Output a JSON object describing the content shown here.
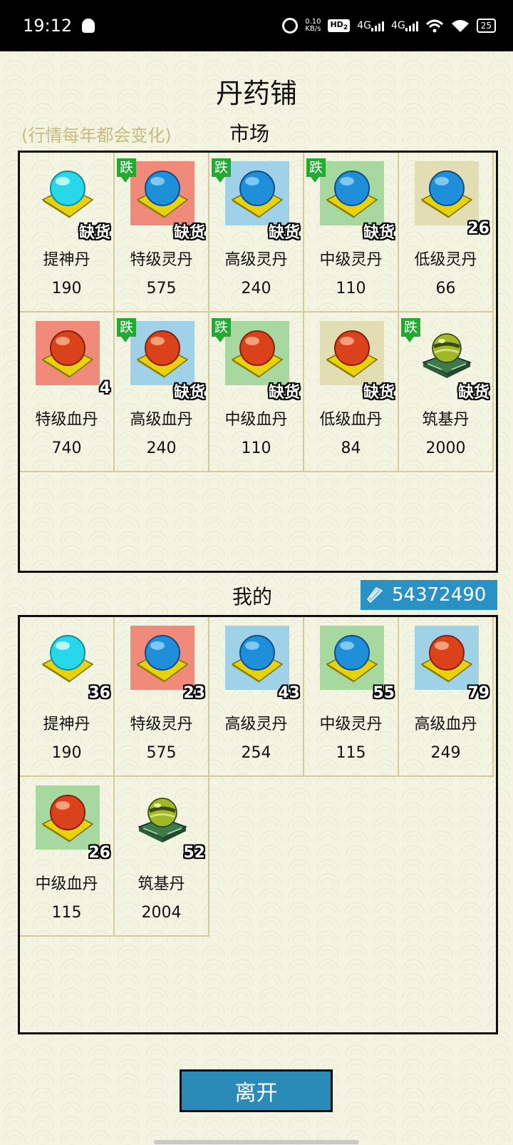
{
  "status_bar": {
    "time": "19:12",
    "net_rate_value": "0.10",
    "net_rate_unit": "KB/s",
    "hd_label": "HD",
    "hd_sub": "2",
    "sig1_label": "4G",
    "sig2_label": "4G",
    "battery": "25"
  },
  "title": "丹药铺",
  "market_note": "(行情每年都会变化)",
  "market_label": "市场",
  "mine_label": "我的",
  "currency_amount": "54372490",
  "leave_button": "离开",
  "colors": {
    "bg_peach": "#f08a7a",
    "bg_blue": "#9fd2e6",
    "bg_green": "#a6d8a0",
    "bg_tan": "#e3ddb4",
    "accent_blue": "#2a91c4",
    "drop_green": "#22aa33"
  },
  "market": [
    {
      "name": "提神丹",
      "price": "190",
      "badge": "缺货",
      "drop": "",
      "gem": "cyan",
      "bg": "none"
    },
    {
      "name": "特级灵丹",
      "price": "575",
      "badge": "缺货",
      "drop": "跌",
      "gem": "blue",
      "bg": "peach"
    },
    {
      "name": "高级灵丹",
      "price": "240",
      "badge": "缺货",
      "drop": "跌",
      "gem": "blue",
      "bg": "blue"
    },
    {
      "name": "中级灵丹",
      "price": "110",
      "badge": "缺货",
      "drop": "跌",
      "gem": "blue",
      "bg": "green"
    },
    {
      "name": "低级灵丹",
      "price": "66",
      "badge": "26",
      "drop": "",
      "gem": "blue",
      "bg": "tan"
    },
    {
      "name": "特级血丹",
      "price": "740",
      "badge": "4",
      "drop": "",
      "gem": "red",
      "bg": "peach"
    },
    {
      "name": "高级血丹",
      "price": "240",
      "badge": "缺货",
      "drop": "跌",
      "gem": "red",
      "bg": "blue"
    },
    {
      "name": "中级血丹",
      "price": "110",
      "badge": "缺货",
      "drop": "跌",
      "gem": "red",
      "bg": "green"
    },
    {
      "name": "低级血丹",
      "price": "84",
      "badge": "缺货",
      "drop": "",
      "gem": "red",
      "bg": "tan"
    },
    {
      "name": "筑基丹",
      "price": "2000",
      "badge": "缺货",
      "drop": "跌",
      "gem": "foundation",
      "bg": "none"
    }
  ],
  "mine": [
    {
      "name": "提神丹",
      "price": "190",
      "badge": "36",
      "drop": "",
      "gem": "cyan",
      "bg": "none"
    },
    {
      "name": "特级灵丹",
      "price": "575",
      "badge": "23",
      "drop": "",
      "gem": "blue",
      "bg": "peach"
    },
    {
      "name": "高级灵丹",
      "price": "254",
      "badge": "43",
      "drop": "",
      "gem": "blue",
      "bg": "blue"
    },
    {
      "name": "中级灵丹",
      "price": "115",
      "badge": "55",
      "drop": "",
      "gem": "blue",
      "bg": "green"
    },
    {
      "name": "高级血丹",
      "price": "249",
      "badge": "79",
      "drop": "",
      "gem": "red",
      "bg": "blue"
    },
    {
      "name": "中级血丹",
      "price": "115",
      "badge": "26",
      "drop": "",
      "gem": "red",
      "bg": "green"
    },
    {
      "name": "筑基丹",
      "price": "2004",
      "badge": "52",
      "drop": "",
      "gem": "foundation",
      "bg": "none"
    }
  ]
}
